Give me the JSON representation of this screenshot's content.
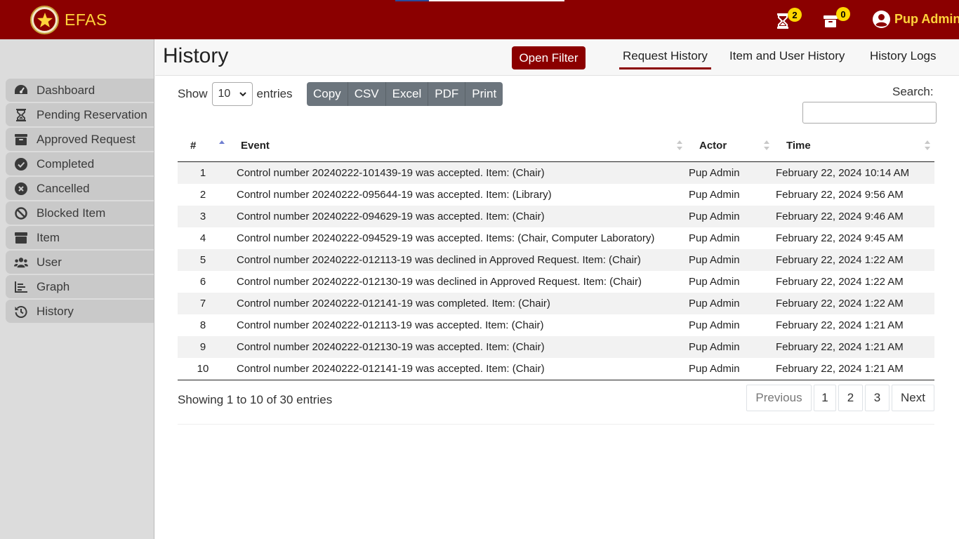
{
  "app": {
    "name": "EFAS"
  },
  "topbar": {
    "pending_count": "2",
    "archive_count": "0",
    "user_name": "Pup Admin"
  },
  "sidebar": {
    "items": [
      {
        "label": "Dashboard",
        "icon": "gauge-icon"
      },
      {
        "label": "Pending Reservation",
        "icon": "hourglass-icon"
      },
      {
        "label": "Approved Request",
        "icon": "archive-icon"
      },
      {
        "label": "Completed",
        "icon": "check-circle-icon"
      },
      {
        "label": "Cancelled",
        "icon": "x-circle-icon"
      },
      {
        "label": "Blocked Item",
        "icon": "ban-icon"
      },
      {
        "label": "Item",
        "icon": "box-icon"
      },
      {
        "label": "User",
        "icon": "users-icon"
      },
      {
        "label": "Graph",
        "icon": "chart-icon"
      },
      {
        "label": "History",
        "icon": "history-icon"
      }
    ]
  },
  "header": {
    "title": "History",
    "open_filter": "Open Filter",
    "tabs": [
      {
        "label": "Request History",
        "active": true
      },
      {
        "label": "Item and User History",
        "active": false
      },
      {
        "label": "History Logs",
        "active": false
      }
    ]
  },
  "controls": {
    "show_label": "Show",
    "entries_value": "10",
    "entries_label": "entries",
    "buttons": [
      "Copy",
      "CSV",
      "Excel",
      "PDF",
      "Print"
    ],
    "search_label": "Search:",
    "search_value": ""
  },
  "table": {
    "columns": [
      "#",
      "Event",
      "Actor",
      "Time"
    ],
    "rows": [
      {
        "num": "1",
        "event": "Control number 20240222-101439-19 was accepted. Item: (Chair)",
        "actor": "Pup Admin",
        "time": "February 22, 2024 10:14 AM"
      },
      {
        "num": "2",
        "event": "Control number 20240222-095644-19 was accepted. Item: (Library)",
        "actor": "Pup Admin",
        "time": "February 22, 2024 9:56 AM"
      },
      {
        "num": "3",
        "event": "Control number 20240222-094629-19 was accepted. Item: (Chair)",
        "actor": "Pup Admin",
        "time": "February 22, 2024 9:46 AM"
      },
      {
        "num": "4",
        "event": "Control number 20240222-094529-19 was accepted. Items: (Chair, Computer Laboratory)",
        "actor": "Pup Admin",
        "time": "February 22, 2024 9:45 AM"
      },
      {
        "num": "5",
        "event": "Control number 20240222-012113-19 was declined in Approved Request. Item: (Chair)",
        "actor": "Pup Admin",
        "time": "February 22, 2024 1:22 AM"
      },
      {
        "num": "6",
        "event": "Control number 20240222-012130-19 was declined in Approved Request. Item: (Chair)",
        "actor": "Pup Admin",
        "time": "February 22, 2024 1:22 AM"
      },
      {
        "num": "7",
        "event": "Control number 20240222-012141-19 was completed. Item: (Chair)",
        "actor": "Pup Admin",
        "time": "February 22, 2024 1:22 AM"
      },
      {
        "num": "8",
        "event": "Control number 20240222-012113-19 was accepted. Item: (Chair)",
        "actor": "Pup Admin",
        "time": "February 22, 2024 1:21 AM"
      },
      {
        "num": "9",
        "event": "Control number 20240222-012130-19 was accepted. Item: (Chair)",
        "actor": "Pup Admin",
        "time": "February 22, 2024 1:21 AM"
      },
      {
        "num": "10",
        "event": "Control number 20240222-012141-19 was accepted. Item: (Chair)",
        "actor": "Pup Admin",
        "time": "February 22, 2024 1:21 AM"
      }
    ]
  },
  "footer": {
    "info": "Showing 1 to 10 of 30 entries",
    "pagination": [
      "Previous",
      "1",
      "2",
      "3",
      "Next"
    ]
  },
  "colors": {
    "brand": "#8b0000",
    "accent": "#ffd43b",
    "badge": "#ffd700",
    "button_gray": "#6c757d"
  }
}
